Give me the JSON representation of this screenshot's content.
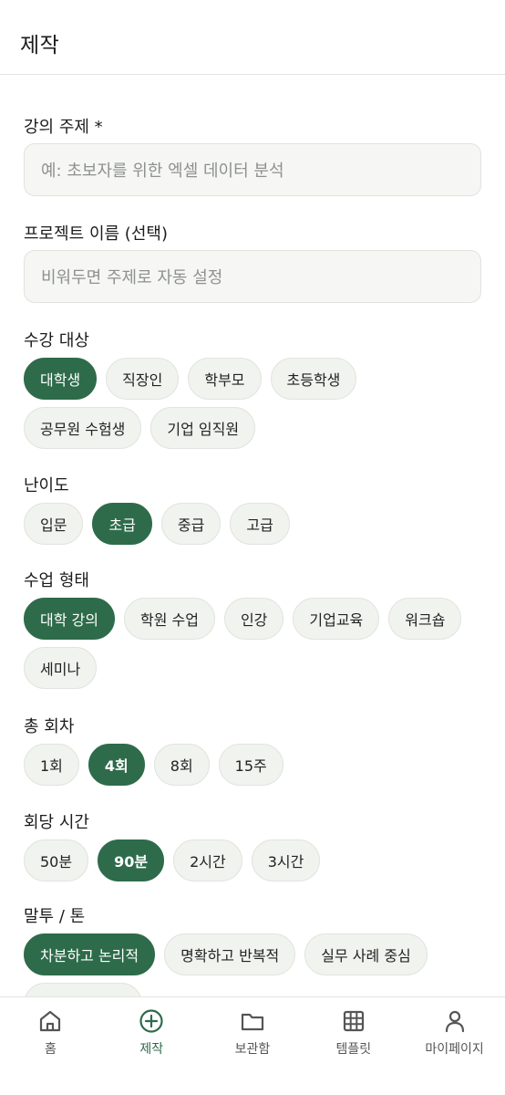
{
  "header": {
    "title": "제작"
  },
  "form": {
    "topic": {
      "label": "강의 주제 *",
      "placeholder": "예: 초보자를 위한 엑셀 데이터 분석"
    },
    "project_name": {
      "label": "프로젝트 이름 (선택)",
      "placeholder": "비워두면 주제로 자동 설정"
    },
    "audience": {
      "label": "수강 대상",
      "options": [
        "대학생",
        "직장인",
        "학부모",
        "초등학생",
        "공무원 수험생",
        "기업 임직원"
      ],
      "selected": "대학생"
    },
    "difficulty": {
      "label": "난이도",
      "options": [
        "입문",
        "초급",
        "중급",
        "고급"
      ],
      "selected": "초급"
    },
    "format": {
      "label": "수업 형태",
      "options": [
        "대학 강의",
        "학원 수업",
        "인강",
        "기업교육",
        "워크숍",
        "세미나"
      ],
      "selected": "대학 강의"
    },
    "sessions": {
      "label": "총 회차",
      "options": [
        "1회",
        "4회",
        "8회",
        "15주"
      ],
      "selected": "4회"
    },
    "duration": {
      "label": "회당 시간",
      "options": [
        "50분",
        "90분",
        "2시간",
        "3시간"
      ],
      "selected": "90분"
    },
    "tone": {
      "label": "말투 / 톤",
      "options": [
        "차분하고 논리적",
        "명확하고 반복적",
        "실무 사례 중심"
      ],
      "selected": "차분하고 논리적"
    }
  },
  "nav": {
    "items": [
      {
        "label": "홈",
        "icon": "home-icon"
      },
      {
        "label": "제작",
        "icon": "plus-circle-icon"
      },
      {
        "label": "보관함",
        "icon": "folder-icon"
      },
      {
        "label": "템플릿",
        "icon": "grid-icon"
      },
      {
        "label": "마이페이지",
        "icon": "user-icon"
      }
    ],
    "active": "제작"
  },
  "colors": {
    "accent": "#2e6b4a",
    "chip_bg": "#f1f3ef",
    "input_bg": "#f6f7f5"
  }
}
